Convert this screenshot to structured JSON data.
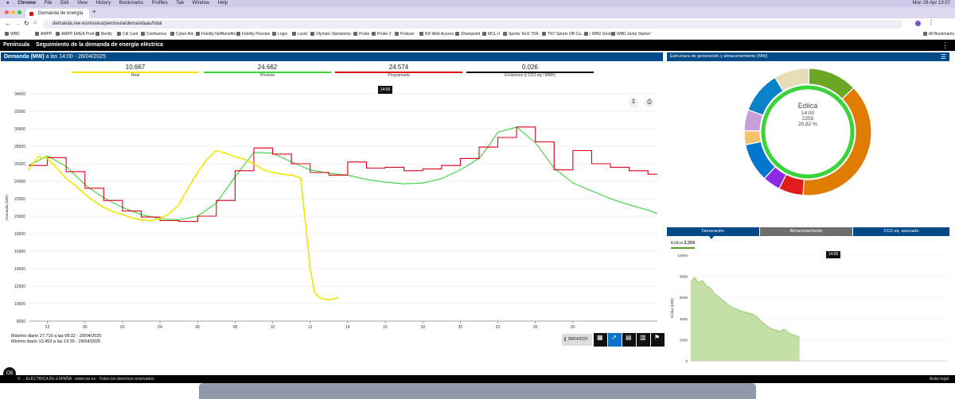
{
  "os": {
    "menu": [
      "Chrome",
      "File",
      "Edit",
      "View",
      "History",
      "Bookmarks",
      "Profiles",
      "Tab",
      "Window",
      "Help"
    ],
    "clock": "Mon 28 Apr  13:07"
  },
  "browser": {
    "tab_title": "Demanda de energía eléctric",
    "url": "demanda.ree.es/visiona/peninsula/demandaau/total",
    "bookmarks": [
      "WBD",
      "AMPP",
      "AMPP EMEA Prod",
      "Benify",
      "Citi Card",
      "Confluence",
      "Cyber Ark",
      "Fidelity NetBenefits",
      "Fidelity Pension",
      "Login",
      "Lucid",
      "Olympic Operations",
      "Probe",
      "Probe 2",
      "Protean",
      "RD Web Access",
      "Sharepoint",
      "MCL-II",
      "Sports Tech TDA",
      "TNT Sports OB Ca...",
      "| WBD Deals",
      "WBD Jump Starter!"
    ],
    "all_bookmarks": "All Bookmarks"
  },
  "app": {
    "region": "Península",
    "title": "Seguimiento de la demanda de energía eléctrica",
    "left_panel": {
      "heading_bold": "Demanda (MW)",
      "heading_rest": " a las 14:00 - 28/04/2025",
      "legend": [
        {
          "value": "10.667",
          "label": "Real",
          "color": "#f2e600"
        },
        {
          "value": "24.662",
          "label": "Prevista",
          "color": "#3ad43a"
        },
        {
          "value": "24.574",
          "label": "Programada",
          "color": "#e0001a"
        },
        {
          "value": "0.026",
          "label": "Emisiones (t CO2 eq./ MWh)",
          "color": "#111111"
        }
      ],
      "tooltip": "14:00",
      "max_text": "Máximo diario 27.710 a las 08:22 - 28/04/2025",
      "min_text": "Mínimo diario 10.453 a las 13:35 - 28/04/2025",
      "date_button": "28/04/2025"
    },
    "right_panel": {
      "heading": "Estructura de generación y almacenamiento (MW)",
      "center_name": "Eólica",
      "center_time": "14:00",
      "center_value": "2255",
      "center_pct": "20,82 %",
      "tabs": [
        "Generación",
        "Almacenamiento",
        "CO2 eq. asociado"
      ],
      "series_label": "Eólica",
      "series_value": "2.255",
      "tooltip": "14:00"
    },
    "footer_left": "© ... ELÉCTRICA DE ESPAÑA - www.ree.es - Todos los derechos reservados",
    "footer_right": "Aviso legal"
  },
  "chart_data": [
    {
      "type": "line",
      "ylabel": "Demanda (MW)",
      "ylim": [
        8000,
        34000
      ],
      "yticks": [
        8000,
        10000,
        12000,
        14000,
        16000,
        18000,
        20000,
        22000,
        24000,
        26000,
        28000,
        30000,
        32000,
        34000
      ],
      "xticks": [
        "22",
        "00",
        "02",
        "04",
        "06",
        "08",
        "10",
        "12",
        "14",
        "16",
        "18",
        "20",
        "22",
        "00",
        "02"
      ],
      "x_hours_range": [
        21,
        30.5
      ],
      "series": [
        {
          "name": "Real",
          "color": "#f2e600",
          "x": [
            21,
            21.5,
            22,
            22.5,
            23,
            23.5,
            24,
            24.5,
            25,
            25.5,
            26,
            26.5,
            27,
            27.5,
            28,
            28.5,
            29,
            29.5,
            30,
            30.5,
            31,
            31.5,
            32,
            32.5,
            33,
            33.5,
            34,
            34.5,
            35,
            35.5,
            36,
            36.25,
            36.5,
            36.75,
            37,
            37.25,
            37.5
          ],
          "y": [
            25300,
            26800,
            26600,
            25500,
            24300,
            23500,
            22500,
            21700,
            21000,
            20500,
            20200,
            19800,
            19600,
            19500,
            19700,
            20300,
            21300,
            23200,
            25000,
            26500,
            27500,
            27200,
            26800,
            26500,
            26000,
            25300,
            25000,
            24800,
            24700,
            24400,
            14000,
            11200,
            10700,
            10500,
            10450,
            10550,
            10667
          ]
        },
        {
          "name": "Prevista",
          "color": "#3ad43a",
          "x": [
            21,
            22,
            23,
            24,
            25,
            26,
            27,
            28,
            29,
            30,
            31,
            32,
            33,
            34,
            35,
            36,
            37,
            38,
            39,
            40,
            41,
            42,
            43,
            44,
            45,
            45.5,
            46,
            47,
            48,
            49,
            50,
            51,
            52,
            53,
            54,
            54.5
          ],
          "y": [
            25800,
            26900,
            25700,
            23600,
            22100,
            21000,
            20200,
            19700,
            19600,
            20000,
            21500,
            24500,
            27300,
            27200,
            26200,
            25300,
            24900,
            24700,
            24200,
            23900,
            23700,
            23800,
            24300,
            25300,
            26600,
            28000,
            29600,
            30200,
            28400,
            25500,
            23800,
            22900,
            22000,
            21300,
            20700,
            20300
          ]
        },
        {
          "name": "Programada",
          "color": "#e0001a",
          "x": [
            21,
            22,
            23,
            24,
            25,
            26,
            27,
            28,
            29,
            30,
            31,
            32,
            33,
            34,
            35,
            36,
            37,
            38,
            39,
            40,
            41,
            42,
            43,
            44,
            45,
            46,
            47,
            48,
            49,
            50,
            51,
            52,
            53,
            54,
            54.5
          ],
          "y": [
            25800,
            26700,
            25100,
            23200,
            21800,
            20600,
            19900,
            19500,
            19400,
            20000,
            21800,
            25200,
            27800,
            27100,
            26000,
            25000,
            24700,
            26200,
            25500,
            25600,
            25200,
            25400,
            25800,
            26600,
            27900,
            29000,
            30200,
            28500,
            25300,
            27500,
            26000,
            25600,
            25200,
            24800,
            24800
          ]
        }
      ]
    },
    {
      "type": "pie",
      "title": "Estructura de generación y almacenamiento (MW)",
      "note": "Donut chart; segment colors as shown, values estimated",
      "values": [
        14,
        43,
        7,
        5,
        11,
        4,
        6,
        12,
        10
      ],
      "colors": [
        "#6aa725",
        "#e07c00",
        "#e01d1d",
        "#8a2be2",
        "#0077cc",
        "#f5c26b",
        "#c8a0d8",
        "#0a82c8",
        "#e5ddb5"
      ],
      "highlight": {
        "name": "Eólica",
        "value": 2255,
        "percent": 20.82
      }
    },
    {
      "type": "area",
      "ylabel": "Eólica (MW)",
      "ylim": [
        0,
        10000
      ],
      "yticks": [
        0,
        2000,
        4000,
        6000,
        8000,
        10000
      ],
      "series": [
        {
          "name": "Eólica",
          "color": "#8dc661",
          "x": [
            0,
            0.5,
            1,
            1.5,
            2,
            2.5,
            3,
            3.5,
            4,
            4.5,
            5,
            5.5,
            6,
            6.5,
            7,
            7.5,
            8,
            8.5,
            9,
            9.5,
            10,
            10.5,
            11,
            11.5,
            12,
            12.5,
            13,
            13.5,
            14
          ],
          "y": [
            7500,
            7900,
            7400,
            7600,
            7100,
            6900,
            6400,
            6100,
            5800,
            5500,
            5200,
            5000,
            4900,
            4700,
            4600,
            4500,
            4400,
            4200,
            3800,
            3500,
            3200,
            3000,
            2900,
            2800,
            3000,
            2700,
            2500,
            2400,
            2255
          ]
        }
      ]
    }
  ]
}
